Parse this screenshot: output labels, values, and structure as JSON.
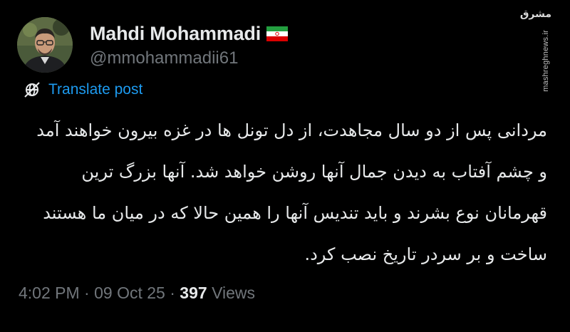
{
  "author": {
    "display_name": "Mahdi Mohammadi",
    "handle": "@mmohammadii61",
    "flag_icon": "iran-flag-icon",
    "avatar_icon": "profile-photo"
  },
  "translate": {
    "label": "Translate post",
    "icon": "globe-slash-icon"
  },
  "post": {
    "text": "مردانی پس از دو سال مجاهدت، از دل تونل ها در غزه بیرون خواهند آمد و چشم آفتاب به دیدن جمال آنها روشن خواهد شد. آنها بزرگ ترین قهرمانان نوع بشرند و باید تندیس آنها را همین حالا که در میان ما هستند ساخت و بر سردر تاریخ نصب کرد."
  },
  "meta": {
    "time": "4:02 PM",
    "separator": " · ",
    "date": "09 Oct 25",
    "views_count": "397",
    "views_label": "Views"
  },
  "watermark": {
    "logo": "مشرق",
    "site": "mashreghnews.ir"
  },
  "colors": {
    "background": "#000000",
    "text_primary": "#e7e9ea",
    "text_secondary": "#71767b",
    "link": "#1d9bf0"
  }
}
